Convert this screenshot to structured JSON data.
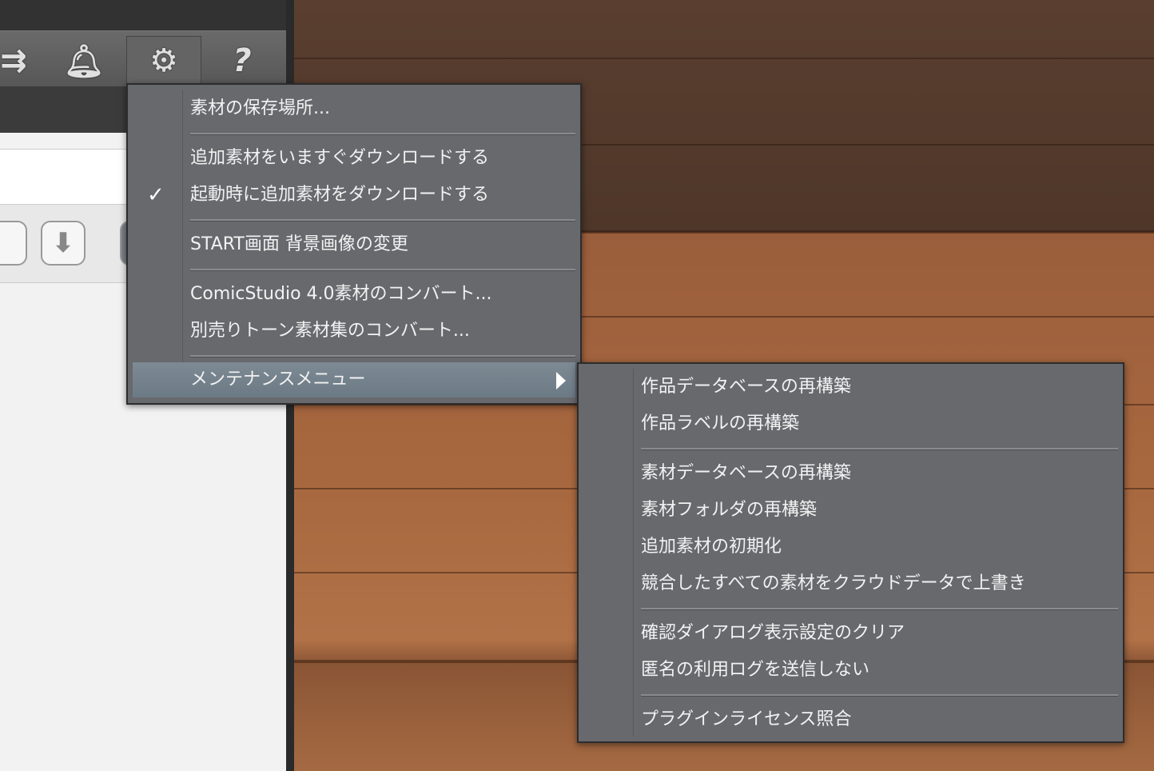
{
  "toolbar": {
    "icons": [
      "arrows-icon",
      "bell-icon",
      "gear-icon",
      "help-icon"
    ],
    "help_glyph": "?"
  },
  "main_menu": {
    "items": [
      {
        "label": "素材の保存場所..."
      },
      {
        "label": "追加素材をいますぐダウンロードする"
      },
      {
        "label": "起動時に追加素材をダウンロードする",
        "checked": true,
        "check": "✓"
      },
      {
        "label": "START画面 背景画像の変更"
      },
      {
        "label": "ComicStudio 4.0素材のコンバート..."
      },
      {
        "label": "別売りトーン素材集のコンバート..."
      },
      {
        "label": "メンテナンスメニュー",
        "highlighted": true,
        "submenu": true
      }
    ]
  },
  "submenu": {
    "items": [
      {
        "label": "作品データベースの再構築"
      },
      {
        "label": "作品ラベルの再構築"
      },
      {
        "label": "素材データベースの再構築"
      },
      {
        "label": "素材フォルダの再構築"
      },
      {
        "label": "追加素材の初期化"
      },
      {
        "label": "競合したすべての素材をクラウドデータで上書き"
      },
      {
        "label": "確認ダイアログ表示設定のクリア"
      },
      {
        "label": "匿名の利用ログを送信しない"
      },
      {
        "label": "プラグインライセンス照合"
      }
    ]
  }
}
